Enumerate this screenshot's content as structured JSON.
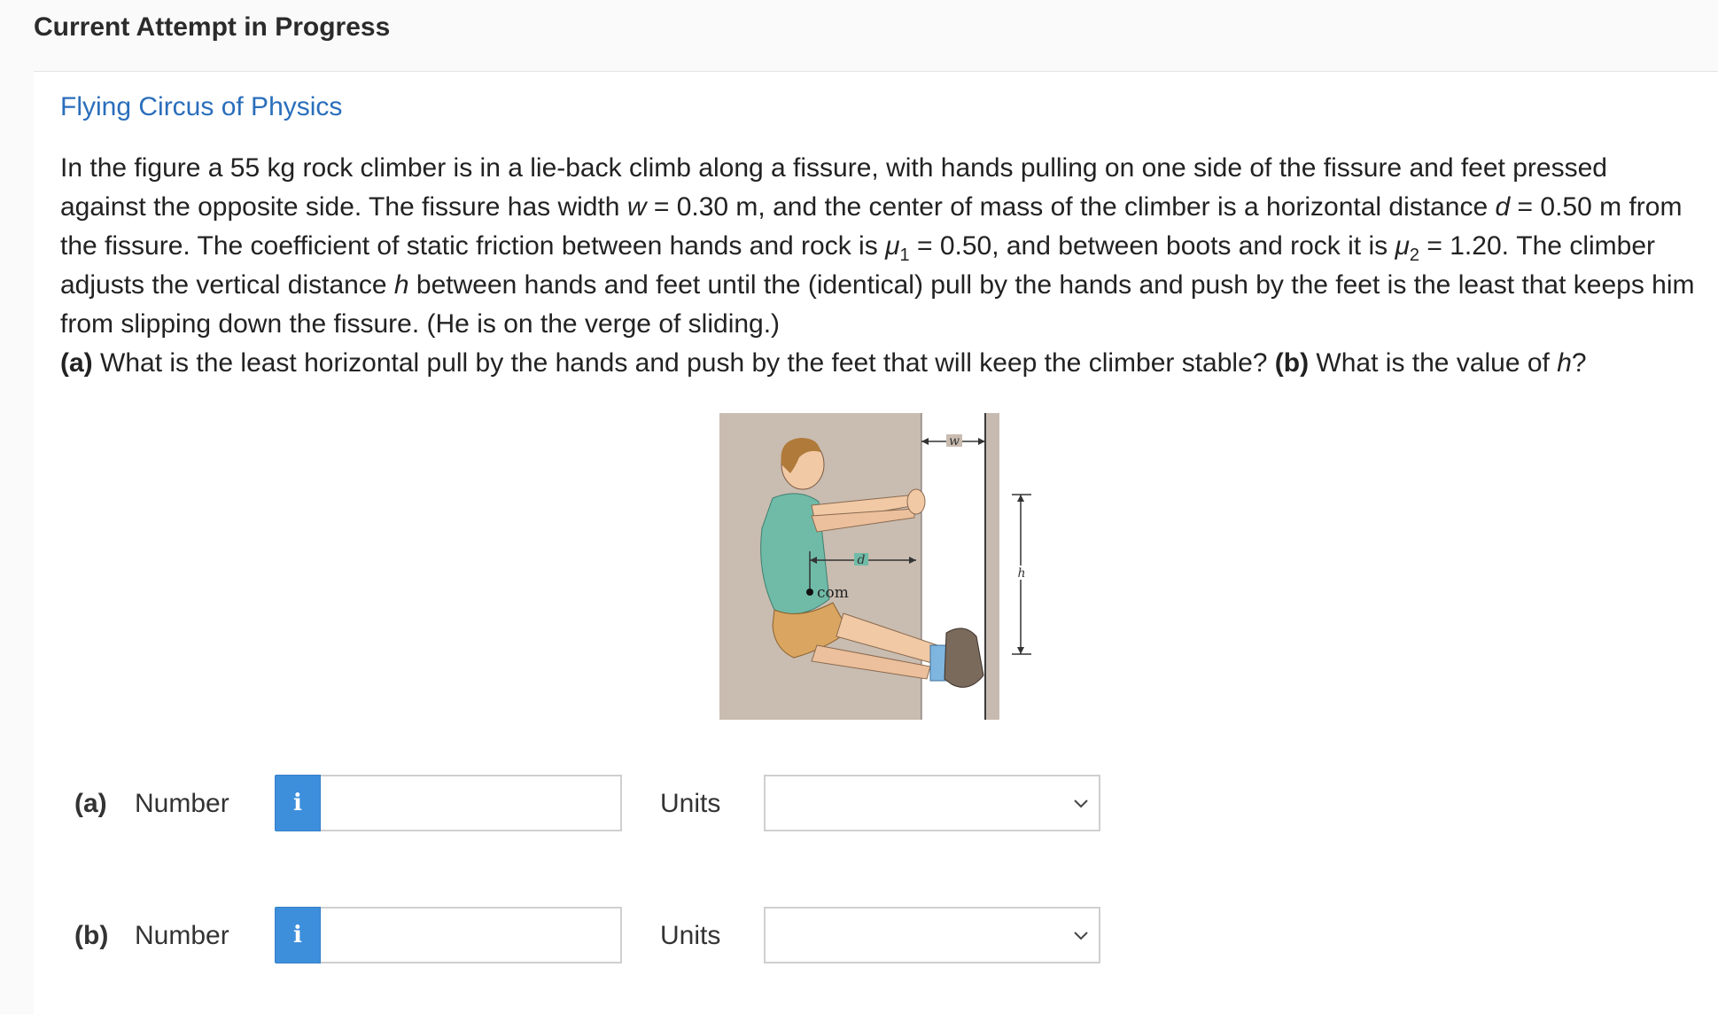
{
  "header": {
    "title": "Current Attempt in Progress"
  },
  "problem": {
    "source": "Flying Circus of Physics",
    "p1": "In the figure a 55 kg rock climber is in a lie-back climb along a fissure, with hands pulling on one side of the fissure and feet pressed against the opposite side. The fissure has width ",
    "w_sym": "w",
    "p2": " = 0.30 m, and the center of mass of the climber is a horizontal distance ",
    "d_sym": "d",
    "p3": " = 0.50 m from the fissure. The coefficient of static friction between hands and rock is ",
    "mu": "μ",
    "mu1_sub": "1",
    "p4": " = 0.50, and between boots and rock it is ",
    "mu2_sub": "2",
    "p5": " = 1.20. The climber adjusts the vertical distance ",
    "h_sym": "h",
    "p6": " between hands and feet until the (identical) pull by the hands and push by the feet is the least that keeps him from slipping down the fissure. (He is on the verge of sliding.)",
    "qa_label": "(a)",
    "qa_text": " What is the least horizontal pull by the hands and push by the feet that will keep the climber stable? ",
    "qb_label": "(b)",
    "qb_text": " What is the value of ",
    "qb_end": "?"
  },
  "figure": {
    "label_w": "w",
    "label_d": "d",
    "label_h": "h",
    "label_com": "com"
  },
  "answers": [
    {
      "part": "(a)",
      "number_label": "Number",
      "info_icon": "i",
      "value": "",
      "units_label": "Units",
      "units_selected": ""
    },
    {
      "part": "(b)",
      "number_label": "Number",
      "info_icon": "i",
      "value": "",
      "units_label": "Units",
      "units_selected": ""
    }
  ],
  "colors": {
    "link": "#2a6ebb",
    "info_button": "#3d8fdc"
  }
}
